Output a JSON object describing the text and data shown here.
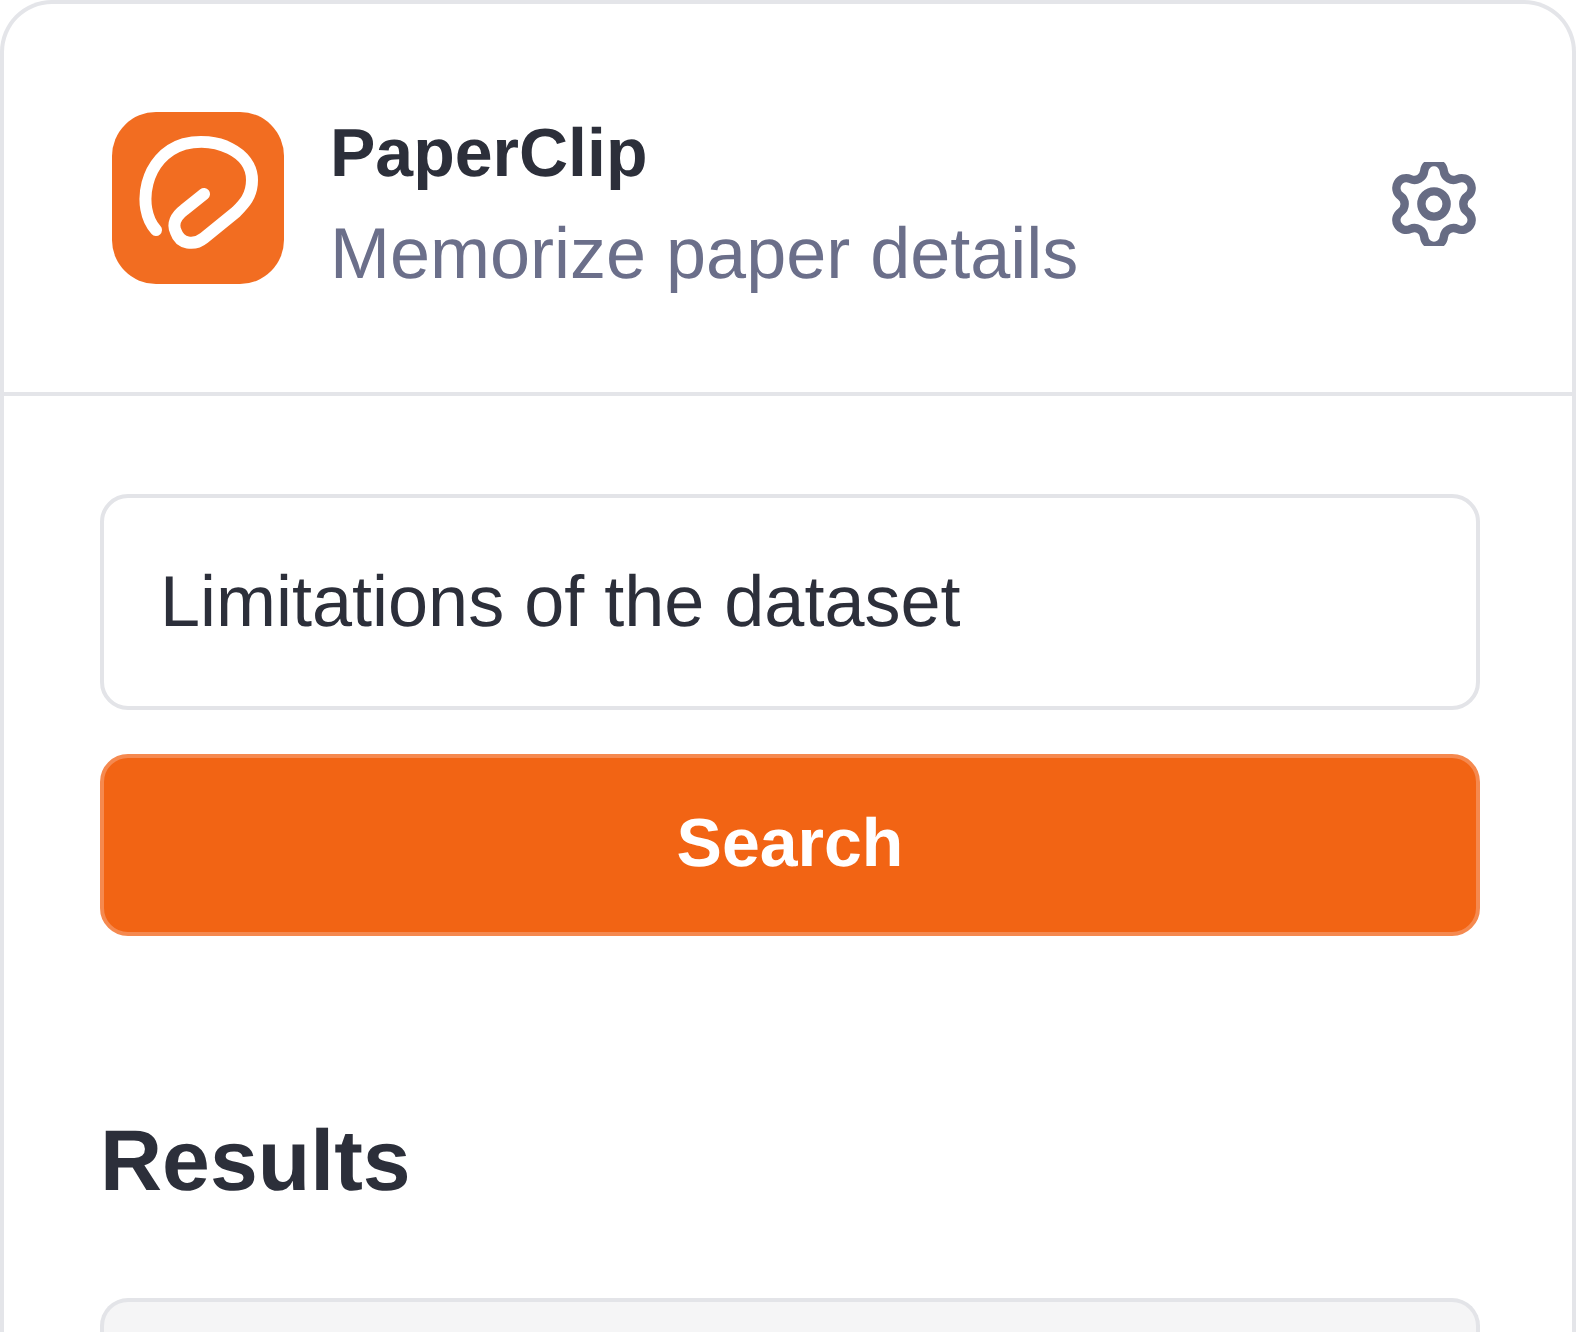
{
  "header": {
    "title": "PaperClip",
    "subtitle": "Memorize paper details"
  },
  "search": {
    "value": "Limitations of the dataset",
    "button": "Search"
  },
  "results": {
    "heading": "Results"
  }
}
